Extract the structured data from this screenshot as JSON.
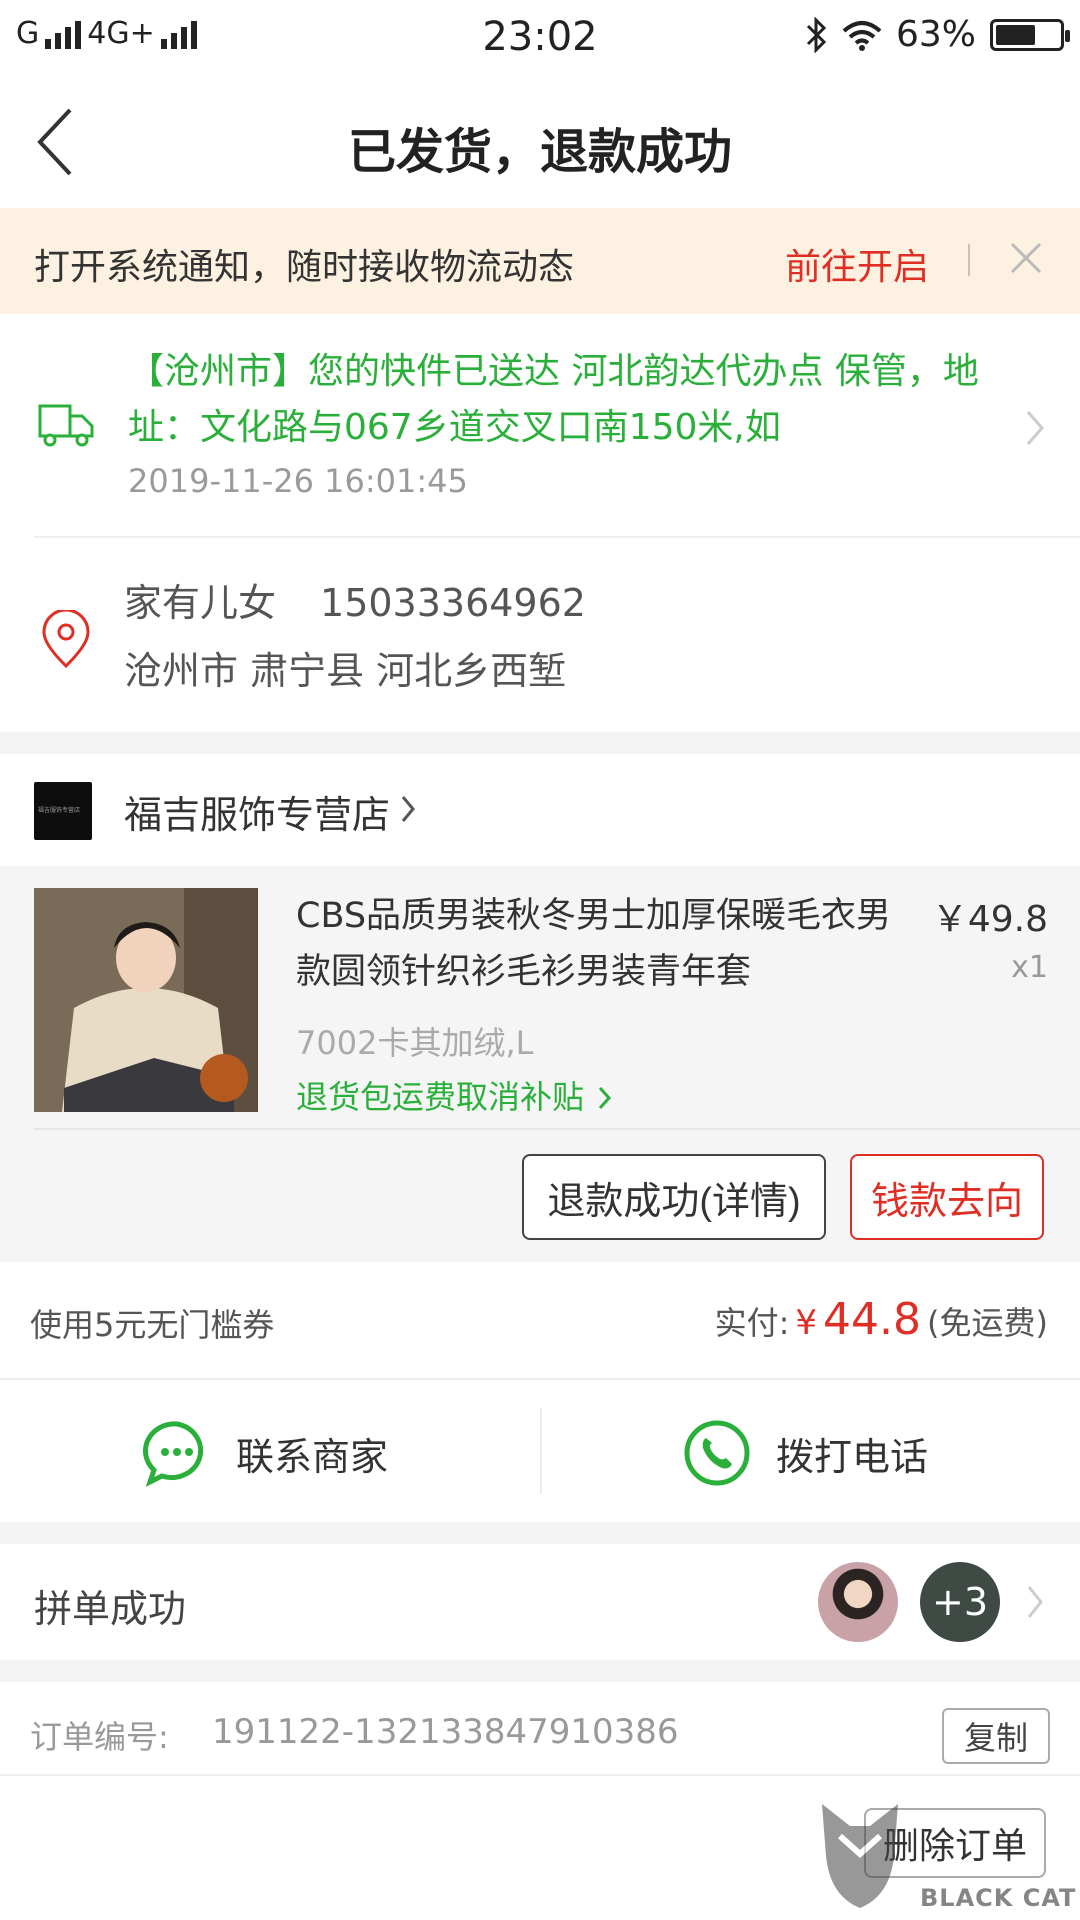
{
  "status_bar": {
    "carrier": "G",
    "network": "4G+",
    "time": "23:02",
    "battery": "63%",
    "battery_level": 0.63
  },
  "nav": {
    "title": "已发货，退款成功"
  },
  "notice": {
    "text": "打开系统通知，随时接收物流动态",
    "action": "前往开启"
  },
  "logistics": {
    "message": "【沧州市】您的快件已送达 河北韵达代办点 保管，地址：文化路与067乡道交叉口南150米,如",
    "time": "2019-11-26 16:01:45"
  },
  "address": {
    "name": "家有儿女",
    "phone": "15033364962",
    "location": "沧州市 肃宁县 河北乡西堑"
  },
  "shop": {
    "name": "福吉服饰专营店"
  },
  "product": {
    "title": "CBS品质男装秋冬男士加厚保暖毛衣男款圆领针织衫毛衫男装青年套",
    "price": "￥49.8",
    "quantity": "x1",
    "sku": "7002卡其加绒,L",
    "subsidy": "退货包运费取消补贴"
  },
  "actions": {
    "refund_detail": "退款成功(详情)",
    "money_flow": "钱款去向"
  },
  "payment": {
    "coupon": "使用5元无门槛券",
    "paid_label": "实付:",
    "currency": "¥",
    "amount": "44.8",
    "shipping": "(免运费)"
  },
  "contact": {
    "merchant": "联系商家",
    "call": "拨打电话"
  },
  "group": {
    "label": "拼单成功",
    "more": "+3"
  },
  "order": {
    "label": "订单编号:",
    "number": "191122-132133847910386",
    "copy": "复制"
  },
  "footer": {
    "delete": "删除订单"
  },
  "watermark": {
    "text": "BLACK CAT"
  },
  "colors": {
    "accent_red": "#e02e24",
    "logistics_green": "#2ab03a",
    "notice_bg": "#fdf1e1"
  }
}
